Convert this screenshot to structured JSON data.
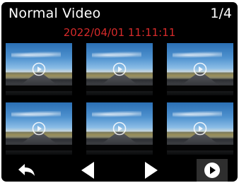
{
  "header": {
    "title": "Normal Video",
    "page_indicator": "1/4"
  },
  "timestamp": "2022/04/01 11:11:11",
  "thumbnails": [
    {
      "icon": "play-circle-icon"
    },
    {
      "icon": "play-circle-icon"
    },
    {
      "icon": "play-circle-icon"
    },
    {
      "icon": "play-circle-icon"
    },
    {
      "icon": "play-circle-icon"
    },
    {
      "icon": "play-circle-icon"
    }
  ],
  "nav": {
    "back_icon": "back-arrow-icon",
    "prev_icon": "previous-page-icon",
    "next_icon": "next-page-icon",
    "play_icon": "play-icon"
  },
  "colors": {
    "background": "#000000",
    "title_text": "#ffffff",
    "timestamp_text": "#d62a2a"
  }
}
